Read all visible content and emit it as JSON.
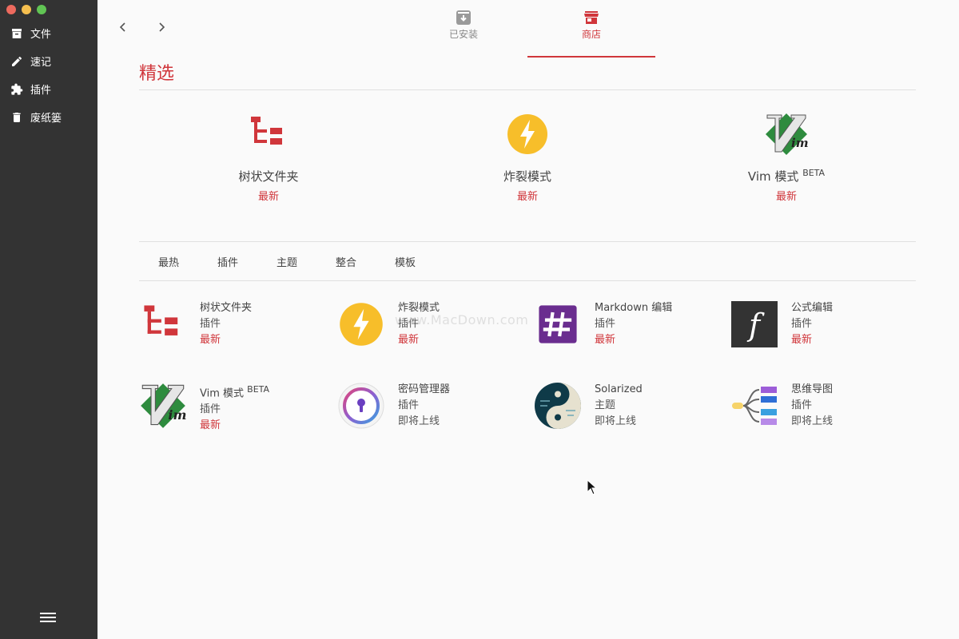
{
  "window": {
    "controls": [
      "close",
      "minimize",
      "maximize"
    ]
  },
  "sidebar": {
    "items": [
      {
        "label": "文件",
        "icon": "archive-icon"
      },
      {
        "label": "速记",
        "icon": "pencil-icon"
      },
      {
        "label": "插件",
        "icon": "puzzle-icon"
      },
      {
        "label": "废纸篓",
        "icon": "trash-icon"
      }
    ],
    "menu_icon": "hamburger-icon"
  },
  "header": {
    "back_icon": "chevron-left-icon",
    "forward_icon": "chevron-right-icon",
    "tabs": [
      {
        "label": "已安装",
        "icon": "download-box-icon",
        "active": false
      },
      {
        "label": "商店",
        "icon": "store-icon",
        "active": true
      }
    ]
  },
  "featured": {
    "title": "精选",
    "items": [
      {
        "name": "树状文件夹",
        "beta": "",
        "status": "最新",
        "icon": "tree-folder-icon"
      },
      {
        "name": "炸裂模式",
        "beta": "",
        "status": "最新",
        "icon": "lightning-icon"
      },
      {
        "name": "Vim 模式",
        "beta": "BETA",
        "status": "最新",
        "icon": "vim-icon"
      }
    ]
  },
  "categories": [
    "最热",
    "插件",
    "主题",
    "整合",
    "模板"
  ],
  "grid": [
    {
      "name": "树状文件夹",
      "beta": "",
      "type": "插件",
      "status": "最新",
      "icon": "tree-folder-icon"
    },
    {
      "name": "炸裂模式",
      "beta": "",
      "type": "插件",
      "status": "最新",
      "icon": "lightning-icon"
    },
    {
      "name": "Markdown 编辑",
      "beta": "",
      "type": "插件",
      "status": "最新",
      "icon": "hash-icon"
    },
    {
      "name": "公式编辑",
      "beta": "",
      "type": "插件",
      "status": "最新",
      "icon": "formula-icon"
    },
    {
      "name": "Vim 模式",
      "beta": "BETA",
      "type": "插件",
      "status": "最新",
      "icon": "vim-icon"
    },
    {
      "name": "密码管理器",
      "beta": "",
      "type": "插件",
      "status": "即将上线",
      "icon": "keyhole-icon"
    },
    {
      "name": "Solarized",
      "beta": "",
      "type": "主题",
      "status": "即将上线",
      "icon": "yin-yang-icon"
    },
    {
      "name": "思维导图",
      "beta": "",
      "type": "插件",
      "status": "即将上线",
      "icon": "mind-map-icon"
    }
  ],
  "watermark": "www.MacDown.com",
  "colors": {
    "accent": "#d0363b",
    "sidebar": "#333333",
    "lightning": "#f7be2a",
    "hash_bg": "#6a2d8f",
    "formula_bg": "#333333"
  }
}
